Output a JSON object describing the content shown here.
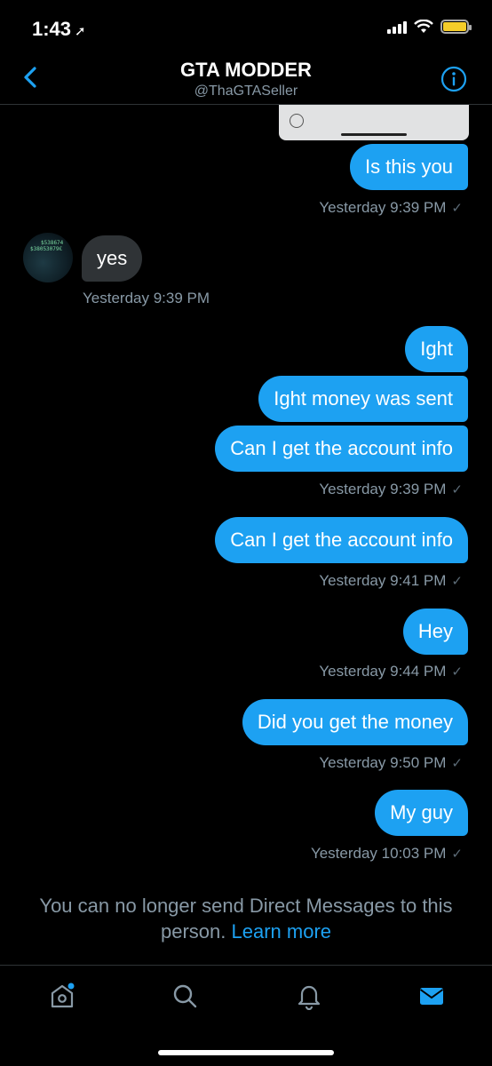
{
  "status": {
    "time": "1:43"
  },
  "header": {
    "title": "GTA MODDER",
    "handle": "@ThaGTASeller"
  },
  "avatar": {
    "text_1": "$538674",
    "text_2": "$38053079€"
  },
  "messages": [
    {
      "text": "Is this you",
      "direction": "out"
    },
    {
      "stamp": "Yesterday 9:39 PM"
    },
    {
      "text": "yes",
      "direction": "in"
    },
    {
      "stamp": "Yesterday 9:39 PM"
    },
    {
      "text": "Ight",
      "direction": "out"
    },
    {
      "text": "Ight money was sent",
      "direction": "out"
    },
    {
      "text": "Can I get the account info",
      "direction": "out"
    },
    {
      "stamp": "Yesterday 9:39 PM"
    },
    {
      "text": "Can I get the account info",
      "direction": "out"
    },
    {
      "stamp": "Yesterday 9:41 PM"
    },
    {
      "text": "Hey",
      "direction": "out"
    },
    {
      "stamp": "Yesterday 9:44 PM"
    },
    {
      "text": "Did you get the money",
      "direction": "out"
    },
    {
      "stamp": "Yesterday 9:50 PM"
    },
    {
      "text": "My guy",
      "direction": "out"
    },
    {
      "stamp": "Yesterday 10:03 PM"
    }
  ],
  "notice": {
    "text_1": "You can no longer send Direct Messages to this",
    "text_2": "person.",
    "link": "Learn more"
  },
  "tabs": [
    "home-icon",
    "search-icon",
    "bell-icon",
    "mail-icon"
  ],
  "colors": {
    "accent": "#1da1f2",
    "incoming_bubble": "#2f3336",
    "muted": "#8899a6"
  }
}
